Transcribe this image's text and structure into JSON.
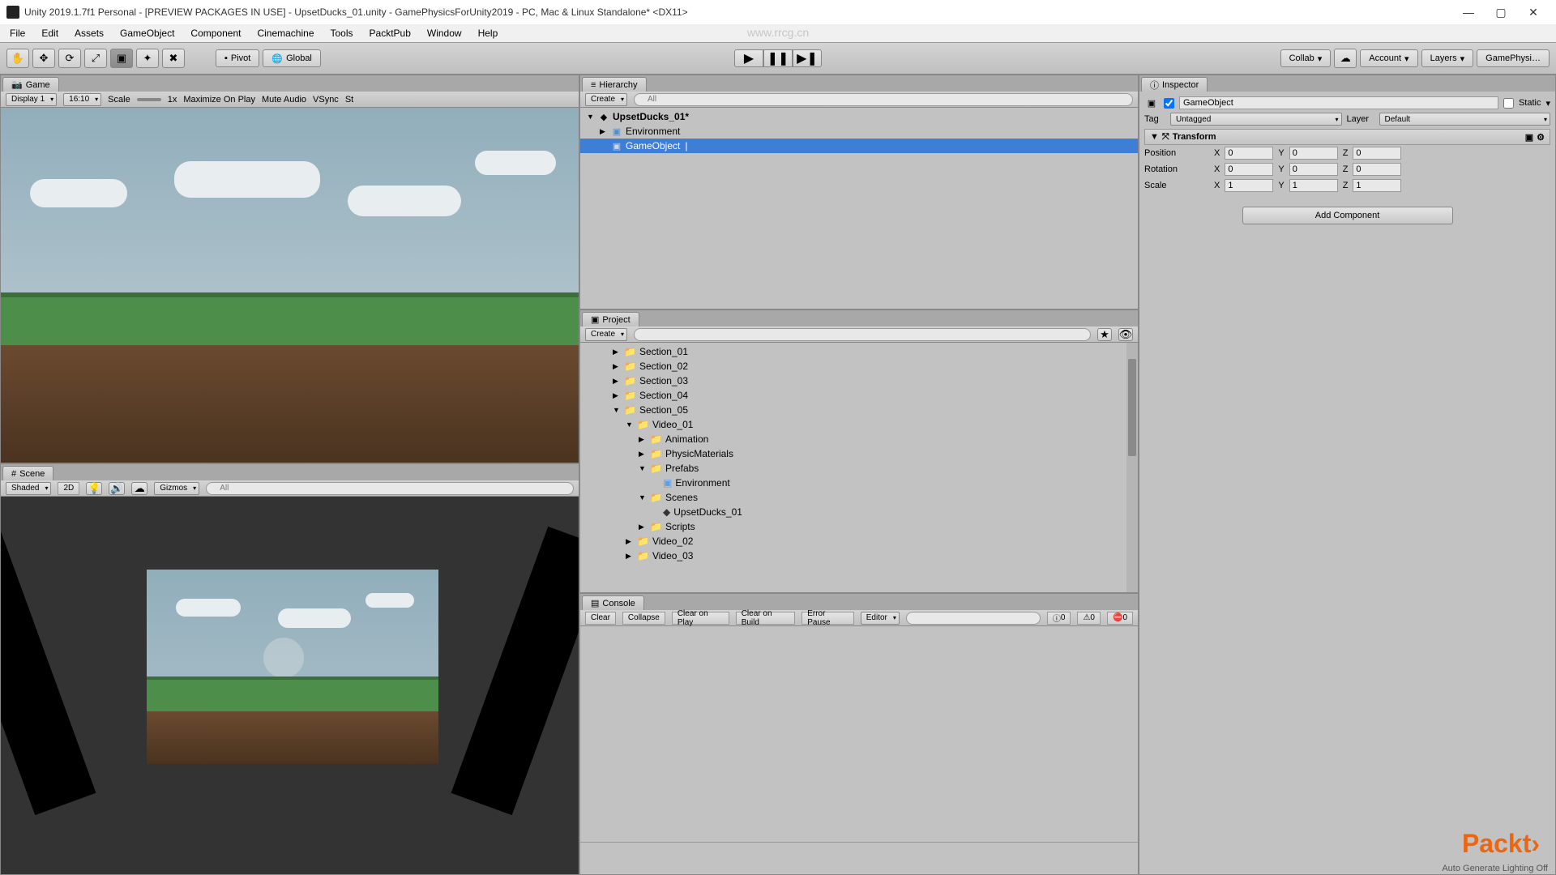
{
  "title": "Unity 2019.1.7f1 Personal - [PREVIEW PACKAGES IN USE] - UpsetDucks_01.unity - GamePhysicsForUnity2019 - PC, Mac & Linux Standalone* <DX11>",
  "menu": [
    "File",
    "Edit",
    "Assets",
    "GameObject",
    "Component",
    "Cinemachine",
    "Tools",
    "PacktPub",
    "Window",
    "Help"
  ],
  "toolbar": {
    "pivot": "Pivot",
    "global": "Global",
    "collab": "Collab",
    "account": "Account",
    "layers": "Layers",
    "layout": "GamePhysi…"
  },
  "game_tab": "Game",
  "game_controls": {
    "display": "Display 1",
    "aspect": "16:10",
    "scale_label": "Scale",
    "scale_val": "1x",
    "maximize": "Maximize On Play",
    "mute": "Mute Audio",
    "vsync": "VSync",
    "stats": "St"
  },
  "scene_tab": "Scene",
  "scene_controls": {
    "shaded": "Shaded",
    "mode2d": "2D",
    "gizmos": "Gizmos"
  },
  "hierarchy": {
    "tab": "Hierarchy",
    "create": "Create",
    "scene_name": "UpsetDucks_01*",
    "items": [
      {
        "label": "Environment",
        "indent": 1
      },
      {
        "label": "GameObject",
        "indent": 1,
        "selected": true
      }
    ]
  },
  "project": {
    "tab": "Project",
    "create": "Create",
    "items": [
      {
        "label": "Section_01",
        "indent": 2,
        "icon": "folder"
      },
      {
        "label": "Section_02",
        "indent": 2,
        "icon": "folder"
      },
      {
        "label": "Section_03",
        "indent": 2,
        "icon": "folder"
      },
      {
        "label": "Section_04",
        "indent": 2,
        "icon": "folder"
      },
      {
        "label": "Section_05",
        "indent": 2,
        "icon": "folder",
        "open": true
      },
      {
        "label": "Video_01",
        "indent": 3,
        "icon": "folder",
        "open": true
      },
      {
        "label": "Animation",
        "indent": 4,
        "icon": "folder"
      },
      {
        "label": "PhysicMaterials",
        "indent": 4,
        "icon": "folder"
      },
      {
        "label": "Prefabs",
        "indent": 4,
        "icon": "folder",
        "open": true
      },
      {
        "label": "Environment",
        "indent": 5,
        "icon": "prefab"
      },
      {
        "label": "Scenes",
        "indent": 4,
        "icon": "folder",
        "open": true
      },
      {
        "label": "UpsetDucks_01",
        "indent": 5,
        "icon": "scene"
      },
      {
        "label": "Scripts",
        "indent": 4,
        "icon": "folder"
      },
      {
        "label": "Video_02",
        "indent": 3,
        "icon": "folder"
      },
      {
        "label": "Video_03",
        "indent": 3,
        "icon": "folder"
      }
    ]
  },
  "console": {
    "tab": "Console",
    "clear": "Clear",
    "collapse": "Collapse",
    "clear_play": "Clear on Play",
    "clear_build": "Clear on Build",
    "error_pause": "Error Pause",
    "editor": "Editor",
    "info_count": "0",
    "warn_count": "0",
    "error_count": "0"
  },
  "inspector": {
    "tab": "Inspector",
    "name": "GameObject",
    "static": "Static",
    "tag_label": "Tag",
    "tag": "Untagged",
    "layer_label": "Layer",
    "layer": "Default",
    "transform": "Transform",
    "position": "Position",
    "rotation": "Rotation",
    "scale": "Scale",
    "pos": {
      "x": "0",
      "y": "0",
      "z": "0"
    },
    "rot": {
      "x": "0",
      "y": "0",
      "z": "0"
    },
    "scl": {
      "x": "1",
      "y": "1",
      "z": "1"
    },
    "add_component": "Add Component"
  },
  "status": "Auto Generate Lighting Off",
  "packt": "Packt›",
  "watermark": "www.rrcg.cn"
}
